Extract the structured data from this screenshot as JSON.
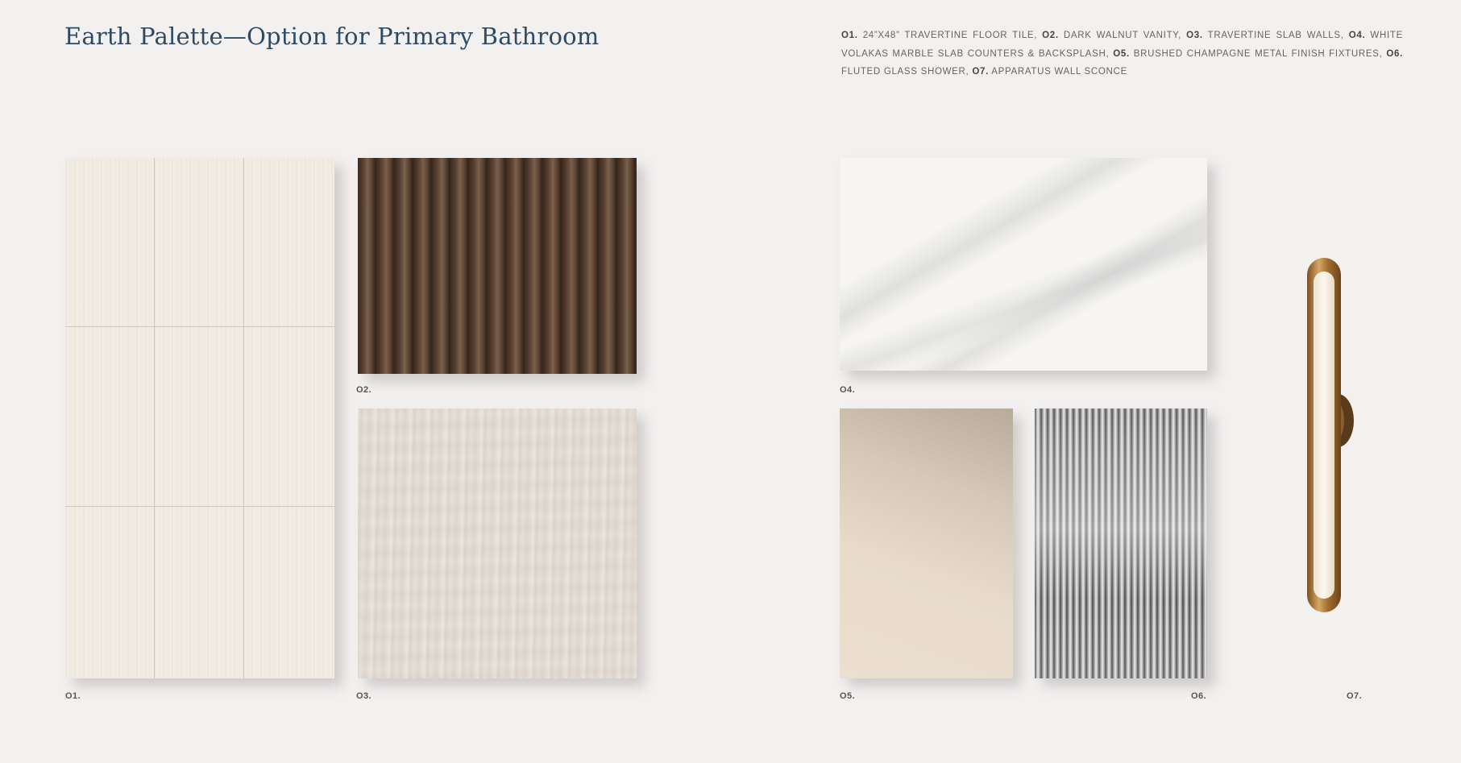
{
  "title": "Earth Palette—Option for Primary Bathroom",
  "legend": [
    {
      "num": "O1.",
      "text": "24”x48” travertine floor tile,"
    },
    {
      "num": "O2.",
      "text": "dark walnut vanity,"
    },
    {
      "num": "O3.",
      "text": "travertine slab walls,"
    },
    {
      "num": "O4.",
      "text": "white volakas marble slab counters & backsplash,"
    },
    {
      "num": "O5.",
      "text": "brushed champagne metal finish fixtures,"
    },
    {
      "num": "O6.",
      "text": "fluted glass shower,"
    },
    {
      "num": "O7.",
      "text": "Apparatus wall sconce"
    }
  ],
  "labels": {
    "s01": "O1.",
    "s02": "O2.",
    "s03": "O3.",
    "s04": "O4.",
    "s05": "O5.",
    "s06": "O6.",
    "s07": "O7."
  },
  "colors": {
    "title": "#2f4a62",
    "background": "#f3f0f0",
    "walnut": "#4a3526",
    "travertine": "#e1dbd3",
    "champagne": "#d6c8b6",
    "brass": "#b07a3c"
  }
}
